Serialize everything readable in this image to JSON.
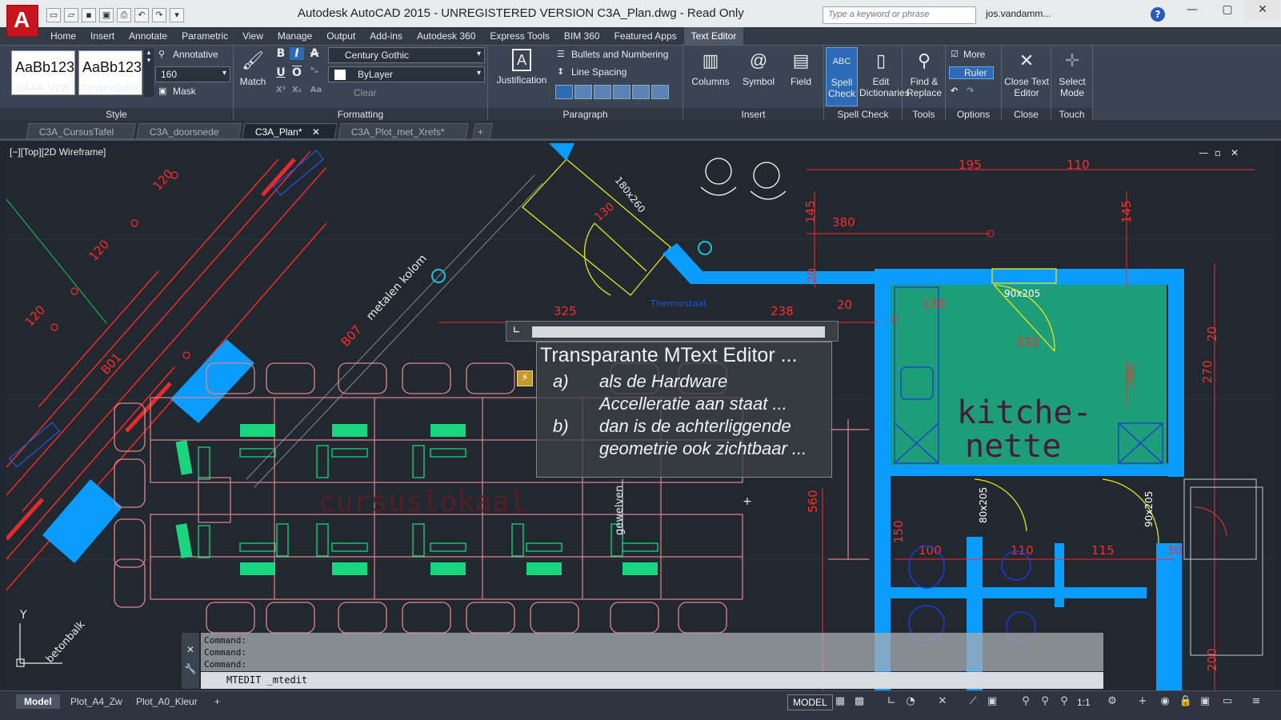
{
  "titlebar": {
    "title": "Autodesk AutoCAD 2015 - UNREGISTERED VERSION     C3A_Plan.dwg - Read Only",
    "search_placeholder": "Type a keyword or phrase",
    "user": "jos.vandamm...",
    "logo": "A"
  },
  "ribbon_tabs": [
    "Home",
    "Insert",
    "Annotate",
    "Parametric",
    "View",
    "Manage",
    "Output",
    "Add-ins",
    "Autodesk 360",
    "Express Tools",
    "BIM 360",
    "Featured Apps",
    "Text Editor"
  ],
  "ribbon": {
    "style": {
      "title": "Style",
      "box1_sample": "AaBb123",
      "box1_caption": "CAAA_VZW",
      "box2_sample": "AaBb123",
      "box2_caption": "CenturyGothic",
      "annotative": "Annotative",
      "height": "160",
      "mask": "Mask"
    },
    "formatting": {
      "title": "Formatting",
      "match": "Match",
      "font": "Century Gothic",
      "color": "ByLayer",
      "clear": "Clear"
    },
    "paragraph": {
      "title": "Paragraph",
      "justification": "Justification",
      "bullets": "Bullets and Numbering",
      "line_spacing": "Line Spacing"
    },
    "insert": {
      "title": "Insert",
      "columns": "Columns",
      "symbol": "Symbol",
      "field": "Field"
    },
    "spell": {
      "title": "Spell Check",
      "spell_check": "Spell Check",
      "edit_dict": "Edit Dictionaries",
      "abc": "ABC"
    },
    "tools": {
      "title": "Tools",
      "find_replace": "Find & Replace"
    },
    "options": {
      "title": "Options",
      "more": "More",
      "ruler": "Ruler"
    },
    "close": {
      "title": "Close",
      "close_editor": "Close Text Editor"
    },
    "touch": {
      "title": "Touch",
      "select_mode": "Select Mode"
    }
  },
  "doc_tabs": [
    "C3A_CursusTafel",
    "C3A_doorsnede",
    "C3A_Plan*",
    "C3A_Plot_met_Xrefs*"
  ],
  "viewport": {
    "label": "[−][Top][2D Wireframe]",
    "labels": {
      "kitchen1": "kitche-",
      "kitchen2": "nette",
      "cursus": "cursuslokaal",
      "metalen": "metalen kolom",
      "gewelven": "gewelven",
      "betonbalk": "betonbalk",
      "thermostaat": "Thermostaat",
      "dim_180x260": "180x260",
      "dim_90x205a": "90x205",
      "dim_80x205": "80x205",
      "dim_90x205b": "90x205",
      "d195": "195",
      "d110": "110",
      "d380": "380",
      "d145a": "145",
      "d145b": "145",
      "d20a": "20",
      "d20b": "20",
      "d20c": "20",
      "d130": "130",
      "d325": "325",
      "d238": "238",
      "d355": "355",
      "d240": "240",
      "d270": "270",
      "d560": "560",
      "d150": "150",
      "d100": "100",
      "d110b": "110",
      "d115": "115",
      "d200": "200",
      "d120a": "120",
      "d120b": "120",
      "d120c": "120",
      "d130b": "130",
      "b07": "B07",
      "b01": "B01",
      "d30": "30",
      "axis_y": "Y"
    }
  },
  "mtext": {
    "title": "Transparante MText Editor ...",
    "a_label": "a)",
    "a_line1": "als de Hardware",
    "a_line2": "Accelleratie aan staat ...",
    "b_label": "b)",
    "b_line1": "dan is de achterliggende",
    "b_line2": "geometrie ook zichtbaar ..."
  },
  "command": {
    "history": [
      "Command:",
      "Command:",
      "Command:"
    ],
    "input": "MTEDIT _mtedit"
  },
  "status": {
    "layout_tabs": [
      "Model",
      "Plot_A4_Zw",
      "Plot_A0_Kleur"
    ],
    "model": "MODEL",
    "scale": "1:1"
  },
  "colors": {
    "accent_blue": "#0aa0ff",
    "dim_red": "#e0242a",
    "kitchen_fill": "#1e9e78",
    "furniture_pink": "#e3858b",
    "equipment_green": "#19e083"
  }
}
